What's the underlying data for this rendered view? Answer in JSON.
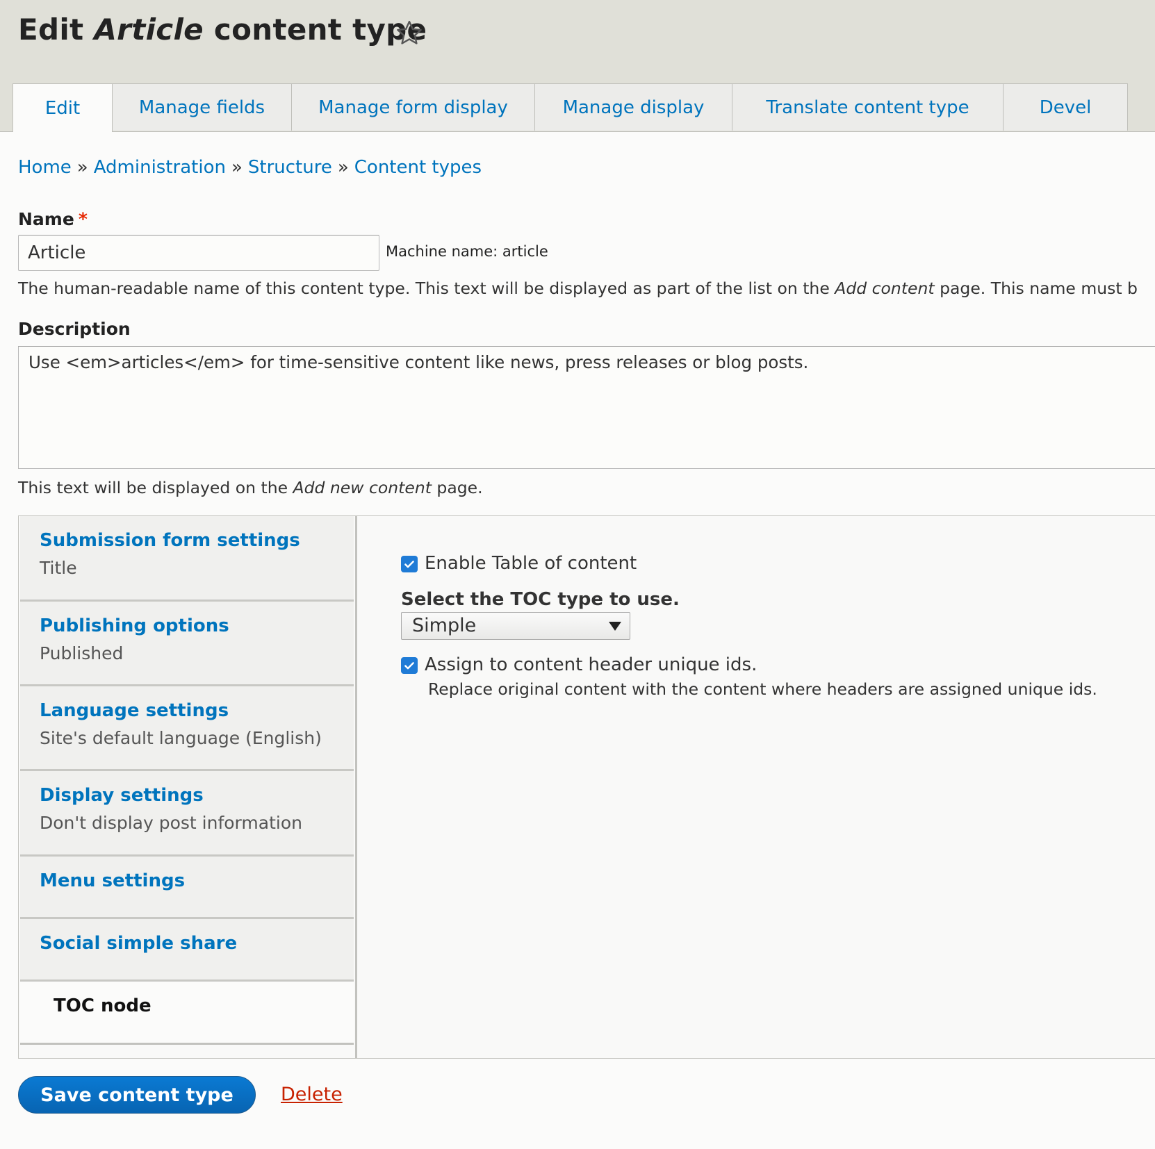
{
  "header": {
    "title_prefix": "Edit",
    "title_em": "Article",
    "title_suffix": "content type"
  },
  "tabs": [
    {
      "label": "Edit",
      "active": true
    },
    {
      "label": "Manage fields"
    },
    {
      "label": "Manage form display"
    },
    {
      "label": "Manage display"
    },
    {
      "label": "Translate content type"
    },
    {
      "label": "Devel"
    }
  ],
  "breadcrumb": {
    "items": [
      "Home",
      "Administration",
      "Structure",
      "Content types"
    ],
    "separator": "»"
  },
  "name_field": {
    "label": "Name",
    "required_marker": "*",
    "value": "Article",
    "machine_name": "Machine name: article",
    "help_before": "The human-readable name of this content type. This text will be displayed as part of the list on the ",
    "help_em": "Add content",
    "help_after": " page. This name must b"
  },
  "description_field": {
    "label": "Description",
    "value": "Use <em>articles</em> for time-sensitive content like news, press releases or blog posts.",
    "help_before": "This text will be displayed on the ",
    "help_em": "Add new content",
    "help_after": " page."
  },
  "vertical_tabs": [
    {
      "title": "Submission form settings",
      "summary": "Title"
    },
    {
      "title": "Publishing options",
      "summary": "Published"
    },
    {
      "title": "Language settings",
      "summary": "Site's default language (English)"
    },
    {
      "title": "Display settings",
      "summary": "Don't display post information"
    },
    {
      "title": "Menu settings",
      "summary": ""
    },
    {
      "title": "Social simple share",
      "summary": ""
    },
    {
      "title": "TOC node",
      "summary": "",
      "active": true
    }
  ],
  "toc_pane": {
    "enable_label": "Enable Table of content",
    "enable_checked": true,
    "type_label": "Select the TOC type to use.",
    "type_value": "Simple",
    "assign_label": "Assign to content header unique ids.",
    "assign_checked": true,
    "assign_help": "Replace original content with the content where headers are assigned unique ids."
  },
  "actions": {
    "save_label": "Save content type",
    "delete_label": "Delete"
  },
  "colors": {
    "link": "#0074bd",
    "primary_button": "#0874c9",
    "delete": "#c72100",
    "required": "#e62600",
    "header_bg": "#e0e0d8"
  },
  "icons": {
    "shortcut": "star-outline-icon",
    "checkbox": "checkmark-icon",
    "select": "caret-down-icon"
  }
}
